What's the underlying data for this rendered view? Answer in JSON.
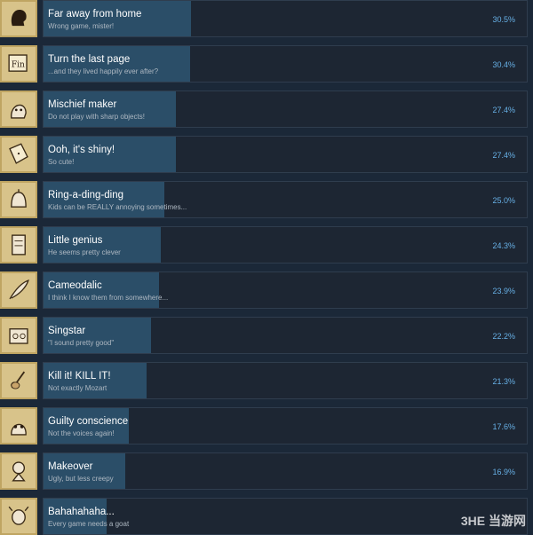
{
  "achievements": [
    {
      "title": "Far away from home",
      "desc": "Wrong game, mister!",
      "pct": "30.5%",
      "icon": "silhouette-face-icon",
      "fraction": 0.305
    },
    {
      "title": "Turn the last page",
      "desc": "...and they lived happily ever after?",
      "pct": "30.4%",
      "icon": "book-fin-icon",
      "fraction": 0.304
    },
    {
      "title": "Mischief maker",
      "desc": "Do not play with sharp objects!",
      "pct": "27.4%",
      "icon": "girl-face-icon",
      "fraction": 0.274
    },
    {
      "title": "Ooh, it's shiny!",
      "desc": "So cute!",
      "pct": "27.4%",
      "icon": "shiny-cloth-icon",
      "fraction": 0.274
    },
    {
      "title": "Ring-a-ding-ding",
      "desc": "Kids can be REALLY annoying sometimes...",
      "pct": "25.0%",
      "icon": "bell-icon",
      "fraction": 0.25
    },
    {
      "title": "Little genius",
      "desc": "He seems pretty clever",
      "pct": "24.3%",
      "icon": "scroll-figure-icon",
      "fraction": 0.243
    },
    {
      "title": "Cameodalic",
      "desc": "I think I know them from somewhere...",
      "pct": "23.9%",
      "icon": "feather-icon",
      "fraction": 0.239
    },
    {
      "title": "Singstar",
      "desc": "\"I sound pretty good\"",
      "pct": "22.2%",
      "icon": "radio-icon",
      "fraction": 0.222
    },
    {
      "title": "Kill it! KILL IT!",
      "desc": "Not exactly Mozart",
      "pct": "21.3%",
      "icon": "violin-icon",
      "fraction": 0.213
    },
    {
      "title": "Guilty conscience",
      "desc": "Not the voices again!",
      "pct": "17.6%",
      "icon": "ghost-face-icon",
      "fraction": 0.176
    },
    {
      "title": "Makeover",
      "desc": "Ugly, but less creepy",
      "pct": "16.9%",
      "icon": "doll-icon",
      "fraction": 0.169
    },
    {
      "title": "Bahahahaha...",
      "desc": "Every game needs a goat",
      "pct": "",
      "icon": "goat-icon",
      "fraction": 0.13
    }
  ],
  "watermark": "3HE 当游网",
  "colors": {
    "background": "#1b2838",
    "fill": "#2b4e68",
    "percent": "#67b0e6",
    "icon_bg": "#d8c38a"
  }
}
